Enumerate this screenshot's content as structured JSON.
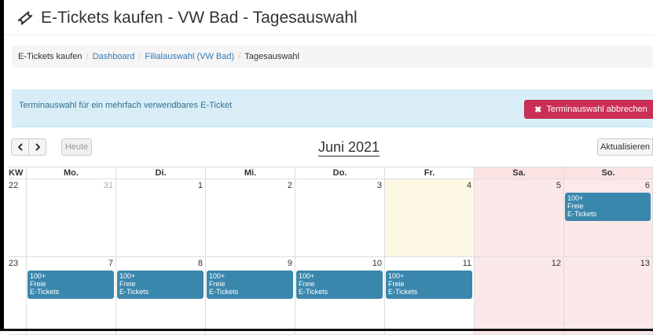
{
  "header": {
    "title": "E-Tickets kaufen - VW Bad - Tagesauswahl",
    "icon": "ticket-icon"
  },
  "breadcrumb": {
    "items": [
      {
        "label": "E-Tickets kaufen",
        "link": false
      },
      {
        "label": "Dashboard",
        "link": true
      },
      {
        "label": "Filialauswahl (VW Bad)",
        "link": true
      },
      {
        "label": "Tagesauswahl",
        "link": false
      }
    ],
    "separator": "/"
  },
  "alert": {
    "text": "Terminauswahl für ein mehrfach verwendbares E-Ticket",
    "cancel_icon": "close-icon",
    "cancel_label": "Terminauswahl abbrechen"
  },
  "toolbar": {
    "prev_icon": "chevron-left-icon",
    "next_icon": "chevron-right-icon",
    "today_label": "Heute",
    "month_title": "Juni 2021",
    "refresh_label": "Aktualisieren"
  },
  "calendar": {
    "kw_label": "KW",
    "weekdays": [
      "Mo.",
      "Di.",
      "Mi.",
      "Do.",
      "Fr.",
      "Sa.",
      "So."
    ],
    "weeks": [
      {
        "kw": "22",
        "days": [
          {
            "num": "31",
            "other_month": true,
            "events": []
          },
          {
            "num": "1",
            "events": []
          },
          {
            "num": "2",
            "events": []
          },
          {
            "num": "3",
            "events": []
          },
          {
            "num": "4",
            "today": true,
            "events": []
          },
          {
            "num": "5",
            "weekend": true,
            "events": []
          },
          {
            "num": "6",
            "weekend": true,
            "events": [
              [
                "100+",
                "Freie",
                "E-Tickets"
              ]
            ]
          }
        ]
      },
      {
        "kw": "23",
        "days": [
          {
            "num": "7",
            "events": [
              [
                "100+",
                "Freie",
                "E-Tickets"
              ]
            ]
          },
          {
            "num": "8",
            "events": [
              [
                "100+",
                "Freie",
                "E-Tickets"
              ]
            ]
          },
          {
            "num": "9",
            "events": [
              [
                "100+",
                "Freie",
                "E-Tickets"
              ]
            ]
          },
          {
            "num": "10",
            "events": [
              [
                "100+",
                "Freie",
                "E-Tickets"
              ]
            ]
          },
          {
            "num": "11",
            "events": [
              [
                "100+",
                "Freie",
                "E-Tickets"
              ]
            ]
          },
          {
            "num": "12",
            "weekend": true,
            "events": []
          },
          {
            "num": "13",
            "weekend": true,
            "events": []
          }
        ]
      }
    ]
  },
  "colors": {
    "event_bg": "#3a87ad",
    "weekend_bg": "#fbe8e8",
    "today_bg": "#fcf8e3",
    "cancel_button_bg": "#cc2f56",
    "alert_bg": "#d9edf7",
    "link": "#337ab7"
  }
}
